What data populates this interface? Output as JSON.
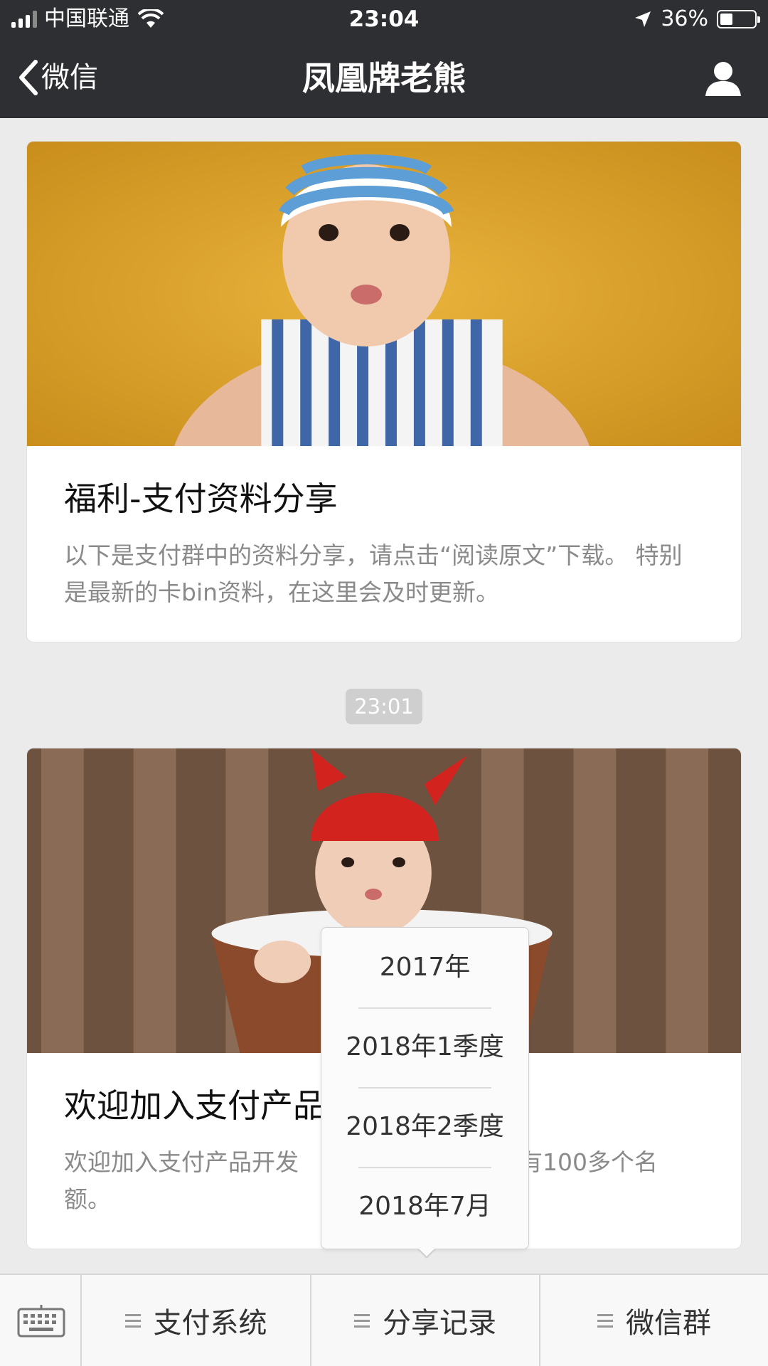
{
  "status_bar": {
    "carrier": "中国联通",
    "time": "23:04",
    "battery_percent": "36%",
    "battery_level": 0.36
  },
  "nav": {
    "back_label": "微信",
    "title": "凤凰牌老熊"
  },
  "articles": [
    {
      "title": "福利-支付资料分享",
      "description": "以下是支付群中的资料分享，请点击“阅读原文”下载。 特别是最新的卡bin资料，在这里会及时更新。"
    },
    {
      "title": "欢迎加入支付产品",
      "description_start": "欢迎加入支付产品开发",
      "description_end": "里还有100多个名额。"
    }
  ],
  "timestamp": "23:01",
  "popup_menu": {
    "items": [
      "2017年",
      "2018年1季度",
      "2018年2季度",
      "2018年7月"
    ]
  },
  "bottom_menu": {
    "items": [
      "支付系统",
      "分享记录",
      "微信群"
    ]
  },
  "colors": {
    "bar_bg": "#2e2f33",
    "page_bg": "#ebebeb"
  }
}
